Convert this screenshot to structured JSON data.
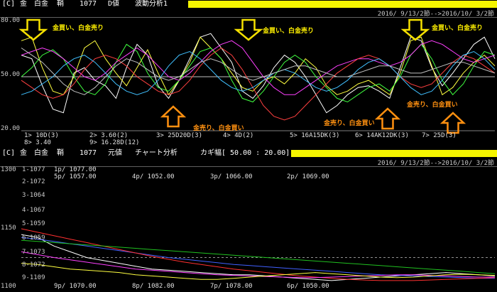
{
  "top_bar": {
    "bracket": "[C]",
    "tabs": [
      "金",
      "白金",
      "鞘",
      "1077",
      "D値",
      "波動分析1"
    ],
    "range": "2016/ 9/13/2節-->2016/10/ 3/2節"
  },
  "bottom_bar": {
    "bracket": "[C]",
    "tabs": [
      "金",
      "白金",
      "鞘",
      "1077",
      "元値",
      "チャート分析"
    ],
    "kagi": "カギ幅[ 50.00 : 20.00]",
    "range": "2016/ 9/13/2節-->2016/10/ 3/2節"
  },
  "colors": {
    "yellow_bar": "#f5f500",
    "buy_arrow": "#f5e000",
    "sell_arrow": "#ff9010"
  },
  "chart_data": [
    {
      "type": "line",
      "title": "波動分析1",
      "ylim": [
        20,
        80
      ],
      "yticks": [
        "80.00",
        "50.00",
        "20.00"
      ],
      "legend_row1": [
        "1> 10D(3)",
        "2> 3.60(2)",
        "3> 25D20D(3)",
        "4> 4D(2)",
        "5> 16A15DK(3)",
        "6> 14AK12DK(3)",
        "7> 25D(3)"
      ],
      "legend_row2": [
        "8> 3.40",
        "9> 16.28D(12)"
      ],
      "annotations": [
        {
          "text": "金買い、白金売り",
          "kind": "buy"
        },
        {
          "text": "金買い、白金売り",
          "kind": "buy"
        },
        {
          "text": "金買い、白金売り",
          "kind": "buy"
        },
        {
          "text": "金売り、白金買い",
          "kind": "sell"
        },
        {
          "text": "金売り、白金買い",
          "kind": "sell"
        },
        {
          "text": "金売り、白金買い",
          "kind": "sell"
        }
      ],
      "series": [
        {
          "color": "#ffffff",
          "values": [
            62,
            60,
            45,
            32,
            30,
            52,
            55,
            48,
            45,
            38,
            55,
            68,
            62,
            45,
            38,
            48,
            60,
            72,
            74,
            66,
            58,
            42,
            38,
            45,
            55,
            62,
            58,
            50,
            40,
            30,
            34,
            40,
            44,
            45,
            42,
            38,
            55,
            72,
            70,
            55,
            45,
            52,
            60,
            68,
            72,
            60
          ]
        },
        {
          "color": "#ffff40",
          "values": [
            70,
            72,
            55,
            42,
            40,
            50,
            66,
            70,
            60,
            52,
            45,
            55,
            65,
            52,
            40,
            48,
            58,
            72,
            66,
            60,
            52,
            44,
            42,
            48,
            50,
            46,
            52,
            60,
            55,
            45,
            40,
            42,
            46,
            48,
            44,
            40,
            52,
            70,
            72,
            56,
            40,
            44,
            52,
            58,
            62,
            56
          ]
        },
        {
          "color": "#40ff40",
          "values": [
            50,
            55,
            62,
            65,
            60,
            50,
            42,
            40,
            46,
            58,
            68,
            64,
            52,
            44,
            42,
            48,
            56,
            64,
            66,
            60,
            48,
            38,
            36,
            42,
            50,
            58,
            62,
            58,
            50,
            44,
            38,
            36,
            40,
            44,
            46,
            42,
            50,
            62,
            68,
            60,
            48,
            40,
            46,
            56,
            64,
            62
          ]
        },
        {
          "color": "#ff40ff",
          "values": [
            62,
            64,
            66,
            64,
            60,
            55,
            50,
            48,
            52,
            58,
            62,
            66,
            62,
            56,
            50,
            48,
            52,
            58,
            64,
            68,
            70,
            66,
            58,
            50,
            44,
            40,
            40,
            44,
            48,
            52,
            56,
            58,
            60,
            60,
            58,
            56,
            58,
            62,
            68,
            70,
            68,
            64,
            60,
            58,
            60,
            62
          ]
        },
        {
          "color": "#ff4040",
          "values": [
            48,
            44,
            40,
            38,
            40,
            46,
            54,
            60,
            62,
            60,
            56,
            50,
            46,
            42,
            40,
            42,
            48,
            56,
            62,
            66,
            62,
            54,
            44,
            34,
            28,
            26,
            28,
            34,
            40,
            46,
            52,
            56,
            60,
            62,
            60,
            56,
            50,
            46,
            44,
            46,
            52,
            58,
            62,
            60,
            56,
            52
          ]
        },
        {
          "color": "#40c0ff",
          "values": [
            40,
            42,
            46,
            50,
            56,
            60,
            62,
            58,
            52,
            46,
            42,
            40,
            42,
            48,
            56,
            62,
            64,
            60,
            54,
            48,
            44,
            42,
            44,
            48,
            52,
            54,
            52,
            48,
            44,
            42,
            44,
            48,
            54,
            58,
            60,
            56,
            50,
            44,
            40,
            42,
            48,
            56,
            62,
            64,
            60,
            54
          ]
        },
        {
          "color": "#c0c0c0",
          "values": [
            66,
            62,
            58,
            52,
            46,
            42,
            40,
            44,
            50,
            56,
            60,
            58,
            54,
            50,
            48,
            50,
            54,
            58,
            60,
            58,
            54,
            50,
            48,
            50,
            52,
            54,
            56,
            56,
            54,
            52,
            50,
            50,
            52,
            54,
            56,
            56,
            54,
            52,
            52,
            54,
            56,
            58,
            58,
            56,
            54,
            52
          ]
        }
      ]
    },
    {
      "type": "line",
      "title": "チャート分析",
      "ylim": [
        1100,
        1300
      ],
      "yticks": [
        "1300",
        "1150",
        "1100"
      ],
      "row_labels": [
        "1-1077",
        "2-1072",
        "3-1064",
        "4-1067",
        "5-1059",
        "6-1059",
        "7-1073",
        "8-1072",
        "9-1109"
      ],
      "price_labels_top": [
        "1p/ 1077.00",
        "5p/ 1057.00",
        "4p/ 1052.00",
        "3p/ 1066.00",
        "2p/ 1069.00"
      ],
      "price_labels_bottom": [
        "9p/ 1070.00",
        "8p/ 1082.00",
        "7p/ 1078.00",
        "6p/ 1050.00"
      ],
      "series": [
        {
          "color": "#ffffff",
          "values": [
            1190,
            1185,
            1170,
            1160,
            1150,
            1145,
            1140,
            1135,
            1130,
            1128,
            1126,
            1124,
            1122,
            1120,
            1120,
            1118,
            1116,
            1114,
            1112,
            1110,
            1112,
            1114,
            1116,
            1118,
            1120,
            1122,
            1124,
            1122,
            1120,
            1118
          ]
        },
        {
          "color": "#4060ff",
          "values": [
            1185,
            1182,
            1178,
            1174,
            1170,
            1166,
            1162,
            1158,
            1154,
            1150,
            1147,
            1144,
            1141,
            1138,
            1136,
            1134,
            1132,
            1130,
            1128,
            1126,
            1124,
            1122,
            1120,
            1119,
            1118,
            1117,
            1116,
            1115,
            1114,
            1114
          ]
        },
        {
          "color": "#ff3030",
          "values": [
            1200,
            1194,
            1188,
            1182,
            1176,
            1170,
            1164,
            1158,
            1152,
            1147,
            1142,
            1138,
            1134,
            1130,
            1127,
            1124,
            1121,
            1118,
            1116,
            1114,
            1112,
            1111,
            1110,
            1110,
            1110,
            1111,
            1112,
            1113,
            1114,
            1115
          ]
        },
        {
          "color": "#20c020",
          "values": [
            1180,
            1178,
            1176,
            1174,
            1172,
            1170,
            1168,
            1166,
            1164,
            1162,
            1160,
            1158,
            1156,
            1154,
            1152,
            1150,
            1148,
            1146,
            1144,
            1142,
            1140,
            1138,
            1136,
            1134,
            1132,
            1130,
            1128,
            1126,
            1124,
            1122
          ]
        },
        {
          "color": "#ff40ff",
          "values": [
            1160,
            1155,
            1150,
            1146,
            1142,
            1138,
            1134,
            1130,
            1128,
            1126,
            1124,
            1122,
            1120,
            1119,
            1118,
            1117,
            1116,
            1115,
            1115,
            1116,
            1117,
            1118,
            1119,
            1120,
            1120,
            1119,
            1118,
            1117,
            1116,
            1116
          ]
        },
        {
          "color": "#ffff40",
          "values": [
            1140,
            1138,
            1134,
            1130,
            1128,
            1126,
            1124,
            1120,
            1118,
            1116,
            1114,
            1112,
            1112,
            1114,
            1116,
            1118,
            1120,
            1122,
            1124,
            1122,
            1120,
            1118,
            1116,
            1115,
            1116,
            1118,
            1120,
            1121,
            1120,
            1119
          ]
        }
      ]
    }
  ]
}
